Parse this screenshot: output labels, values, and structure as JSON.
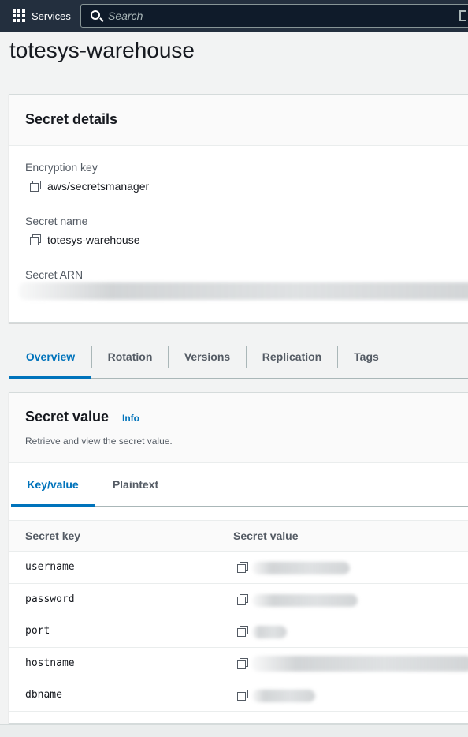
{
  "topnav": {
    "services_label": "Services",
    "search_placeholder": "Search",
    "icons": [
      "grid-icon",
      "search-icon"
    ]
  },
  "page": {
    "title": "totesys-warehouse"
  },
  "secret_details": {
    "title": "Secret details",
    "encryption_key_label": "Encryption key",
    "encryption_key_value": "aws/secretsmanager",
    "secret_name_label": "Secret name",
    "secret_name_value": "totesys-warehouse",
    "secret_arn_label": "Secret ARN"
  },
  "tabs": [
    "Overview",
    "Rotation",
    "Versions",
    "Replication",
    "Tags"
  ],
  "active_tab": "Overview",
  "secret_value": {
    "title": "Secret value",
    "info_link": "Info",
    "description": "Retrieve and view the secret value.",
    "subtabs": [
      "Key/value",
      "Plaintext"
    ],
    "active_subtab": "Key/value",
    "columns": [
      "Secret key",
      "Secret value"
    ],
    "rows": [
      "username",
      "password",
      "port",
      "hostname",
      "dbname"
    ]
  },
  "colors": {
    "accent": "#0073bb",
    "nav_bg": "#232f3e"
  }
}
